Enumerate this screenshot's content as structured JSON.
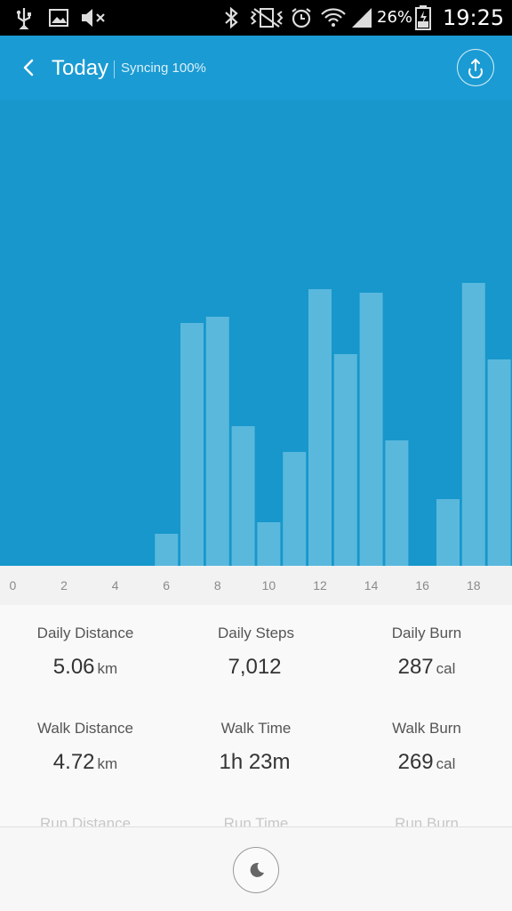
{
  "status_bar": {
    "icons": [
      "usb-icon",
      "image-icon",
      "mute-icon",
      "bluetooth-icon",
      "vibrate-icon",
      "alarm-icon",
      "wifi-icon",
      "signal-icon",
      "battery-icon"
    ],
    "battery_percent": "26%",
    "time": "19:25"
  },
  "header": {
    "title": "Today",
    "sync_status": "Syncing 100%",
    "colors": {
      "bar": "#1a9bd3",
      "chart_bg": "#1797cb",
      "bar_fill": "#5ab8dd"
    }
  },
  "chart_data": {
    "type": "bar",
    "x": [
      6,
      7,
      8,
      9,
      10,
      11,
      12,
      13,
      14,
      15,
      17,
      18,
      19
    ],
    "values": [
      36,
      273,
      280,
      157,
      49,
      128,
      311,
      238,
      307,
      141,
      75,
      318,
      232
    ],
    "xlim": [
      -0.5,
      19.5
    ],
    "ylim": [
      0,
      524
    ],
    "tick_labels": [
      "0",
      "2",
      "4",
      "6",
      "8",
      "10",
      "12",
      "14",
      "16",
      "18"
    ],
    "tick_values": [
      0,
      2,
      4,
      6,
      8,
      10,
      12,
      14,
      16,
      18
    ],
    "grid": false
  },
  "stats": [
    {
      "label": "Daily Distance",
      "value": "5.06",
      "unit": "km"
    },
    {
      "label": "Daily Steps",
      "value": "7,012",
      "unit": ""
    },
    {
      "label": "Daily Burn",
      "value": "287",
      "unit": "cal"
    },
    {
      "label": "Walk Distance",
      "value": "4.72",
      "unit": "km"
    },
    {
      "label": "Walk Time",
      "value": "1h 23m",
      "unit": ""
    },
    {
      "label": "Walk Burn",
      "value": "269",
      "unit": "cal"
    },
    {
      "label": "Run Distance",
      "value": "",
      "unit": ""
    },
    {
      "label": "Run Time",
      "value": "",
      "unit": ""
    },
    {
      "label": "Run Burn",
      "value": "",
      "unit": ""
    }
  ]
}
